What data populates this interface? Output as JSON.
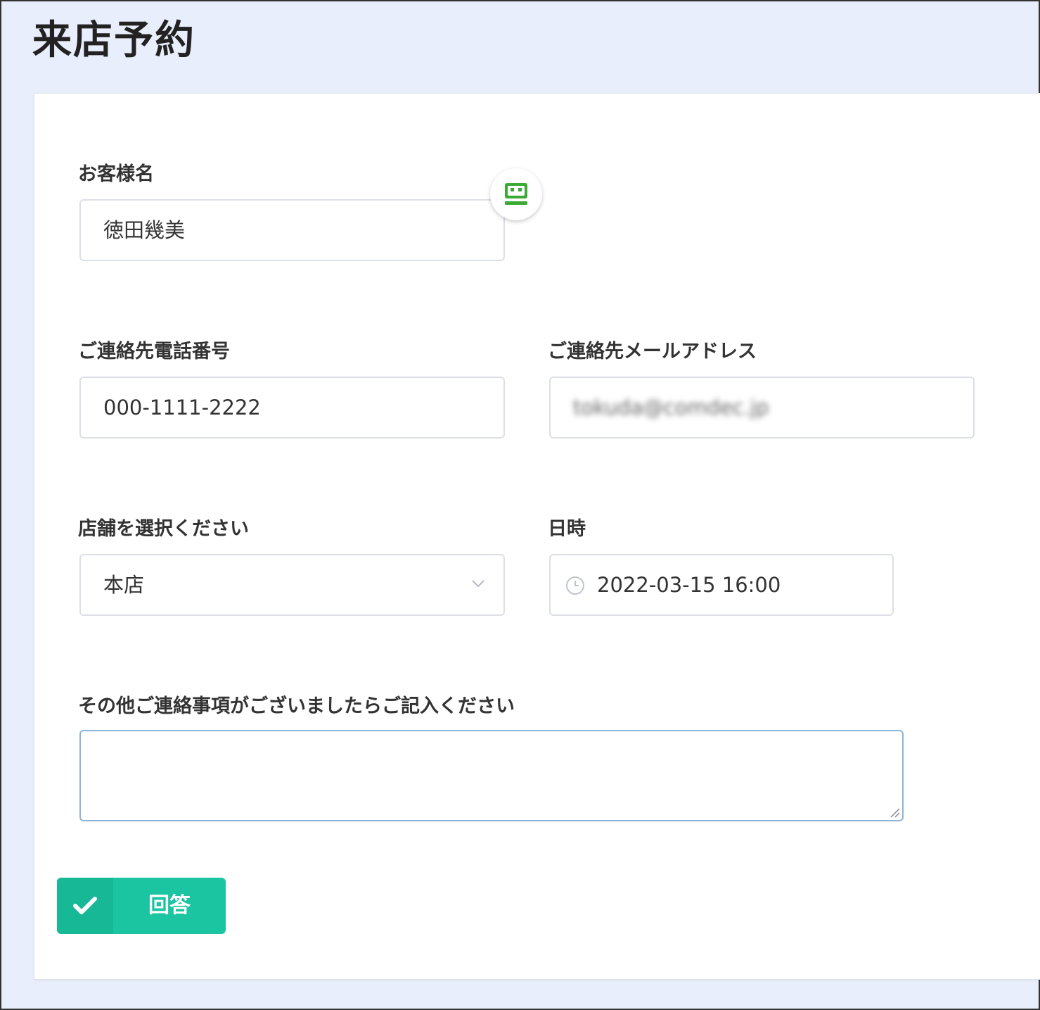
{
  "page": {
    "title": "来店予約"
  },
  "form": {
    "customer_name": {
      "label": "お客様名",
      "value": "徳田幾美"
    },
    "phone": {
      "label": "ご連絡先電話番号",
      "value": "000-1111-2222"
    },
    "email": {
      "label": "ご連絡先メールアドレス",
      "value": "tokuda@comdec.jp"
    },
    "store": {
      "label": "店舗を選択ください",
      "selected": "本店"
    },
    "datetime": {
      "label": "日時",
      "value": "2022-03-15 16:00"
    },
    "notes": {
      "label": "その他ご連絡事項がございましたらご記入ください",
      "value": ""
    },
    "submit": {
      "label": "回答"
    }
  },
  "icons": {
    "assist": "robot-face-icon",
    "select": "chevron-down-icon",
    "datetime": "clock-icon",
    "submit": "checkmark-icon",
    "resize": "resize-grip-icon"
  },
  "colors": {
    "page_background": "#e8eefb",
    "card_background": "#ffffff",
    "accent": "#1bc5a2",
    "accent_dark": "#17b896",
    "input_border": "#dcdfe6",
    "textarea_focus_border": "#8ab4da",
    "assist_icon_green": "#3aaa35"
  }
}
